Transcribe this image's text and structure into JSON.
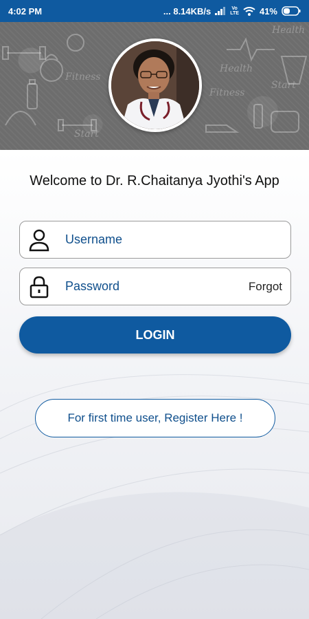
{
  "status_bar": {
    "time": "4:02 PM",
    "network_speed": "... 8.14KB/s",
    "network_type_top": "Vo",
    "network_type_bottom": "LTE",
    "battery": "41%"
  },
  "header": {
    "doodles": [
      "Health",
      "Fitness",
      "Start",
      "Fitness",
      "Start",
      "Health"
    ]
  },
  "welcome_text": "Welcome to Dr. R.Chaitanya Jyothi's App",
  "form": {
    "username_placeholder": "Username",
    "password_placeholder": "Password",
    "forgot_label": "Forgot",
    "login_label": "LOGIN"
  },
  "register_label": "For first time user, Register Here !",
  "colors": {
    "primary": "#0f5aa0",
    "header_bg": "#6d6d6d"
  }
}
